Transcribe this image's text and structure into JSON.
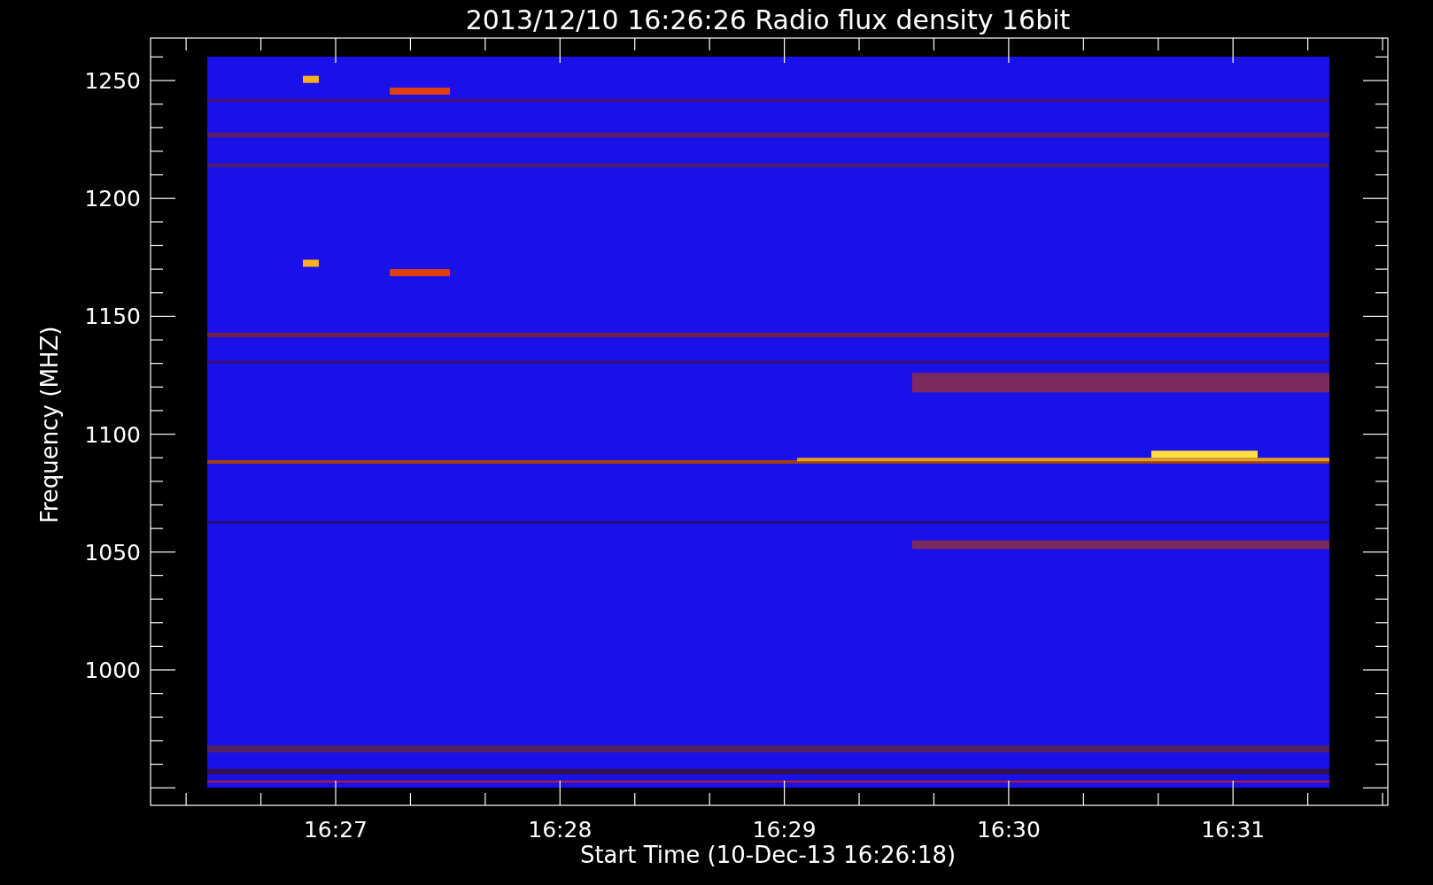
{
  "plot": {
    "title": "2013/12/10 16:26:26 Radio flux density 16bit",
    "y_axis": {
      "label": "Frequency (MHZ)",
      "ticks": [
        "1250",
        "1200",
        "1150",
        "1100",
        "1050",
        "1000"
      ]
    },
    "x_axis": {
      "label": "Start Time (10-Dec-13 16:26:18)",
      "ticks": [
        "16:27",
        "16:28",
        "16:29",
        "16:30",
        "16:31"
      ]
    }
  }
}
